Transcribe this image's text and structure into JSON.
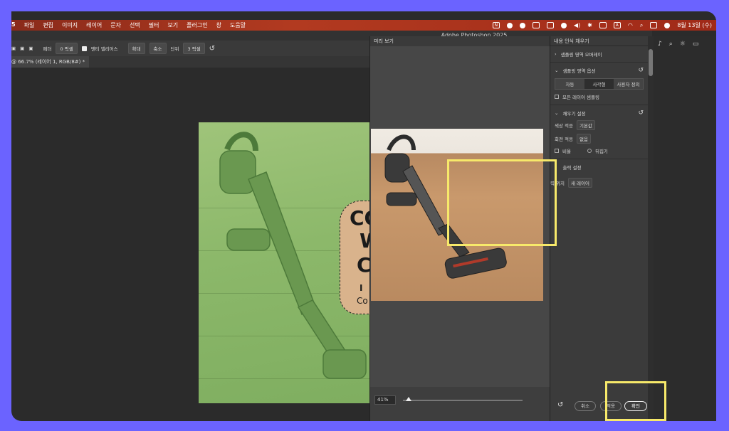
{
  "menubar": {
    "app": "5",
    "items": [
      "파일",
      "편집",
      "이미지",
      "레이어",
      "문자",
      "선택",
      "필터",
      "보기",
      "플러그인",
      "창",
      "도움말"
    ],
    "clock": "8월 13일 (수)"
  },
  "window_title": "Adobe Photoshop 2025",
  "options": {
    "feather_label": "페더",
    "feather_value": "0 픽셀",
    "antialias_label": "앤티 앨리어스",
    "zoom_in": "확대",
    "zoom_out": "축소",
    "unit_label": "단위",
    "unit_value": "3 픽셀"
  },
  "doc_tab": "@ 66.7% (레이어 1, RGB/8#) *",
  "canvas_text": [
    "CO",
    "W",
    "C",
    "I",
    "Co"
  ],
  "preview": {
    "title": "미리 보기",
    "zoom": "41%",
    "zoom_fraction": 0.05
  },
  "panel": {
    "title": "내용 인식 채우기",
    "sampling_overlay": "샘플링 영역 오버레이",
    "sampling_options": "샘플링 영역 옵션",
    "segments": [
      "자동",
      "사각형",
      "사용자 정의"
    ],
    "selected_segment": "사각형",
    "sample_all_layers": "모든 레이어 샘플링",
    "fill_settings": "채우기 설정",
    "color_adapt_label": "색상 적응",
    "color_adapt_value": "기본값",
    "rotation_adapt_label": "회전 적응",
    "rotation_adapt_value": "없음",
    "scale_label": "비율",
    "mirror_label": "뒤집기",
    "output_settings": "출력 설정",
    "output_to_label": "력 위치",
    "output_to_value": "새 레이어",
    "cancel": "취소",
    "apply": "적용",
    "ok": "확인"
  },
  "colors": {
    "highlight": "#f7e96a",
    "menubar": "#b23a20",
    "frame": "#6b63ff"
  }
}
